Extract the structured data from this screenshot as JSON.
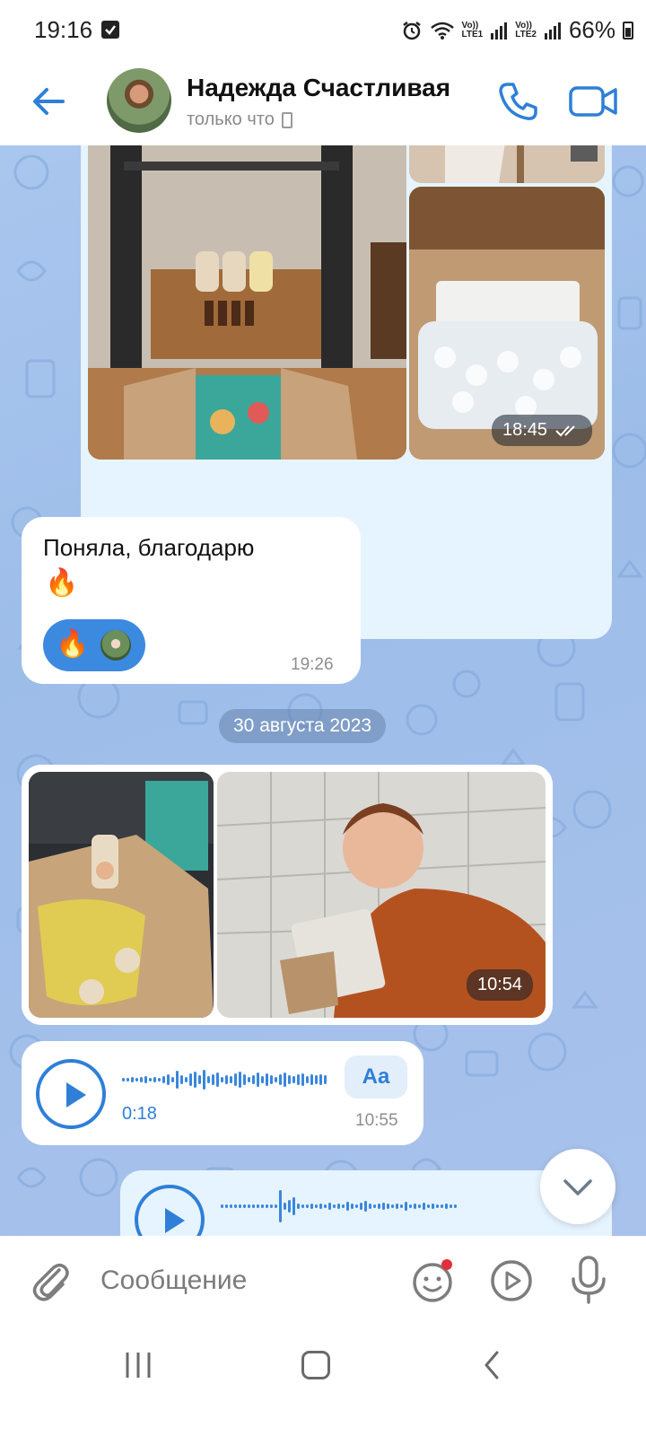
{
  "status_bar": {
    "time": "19:16",
    "network_1": "Vo))\nLTE1",
    "network_2": "Vo))\nLTE2",
    "battery": "66%"
  },
  "header": {
    "contact_name": "Надежда Счастливая",
    "status": "только что"
  },
  "messages": {
    "photo_group_1": {
      "time": "18:45"
    },
    "text_message": {
      "text": "Поняла, благодарю",
      "emoji": "🔥",
      "reaction_emoji": "🔥",
      "time": "19:26"
    },
    "date_separator": "30 августа 2023",
    "photo_group_2": {
      "time": "10:54"
    },
    "voice_message_1": {
      "duration": "0:18",
      "transcribe_label": "Aa",
      "time": "10:55"
    },
    "voice_message_2": {}
  },
  "input": {
    "placeholder": "Сообщение"
  },
  "icons": {
    "back": "arrow-left-icon",
    "call": "phone-icon",
    "video": "video-camera-icon",
    "attach": "paperclip-icon",
    "emoji": "emoji-icon",
    "round_video": "play-circle-icon",
    "mic": "microphone-icon",
    "scroll_down": "chevron-down-icon"
  },
  "colors": {
    "accent": "#2f7fd8",
    "chat_background": "#a9c6ee",
    "bubble_incoming": "#ffffff",
    "bubble_outgoing": "#e6f4ff"
  }
}
